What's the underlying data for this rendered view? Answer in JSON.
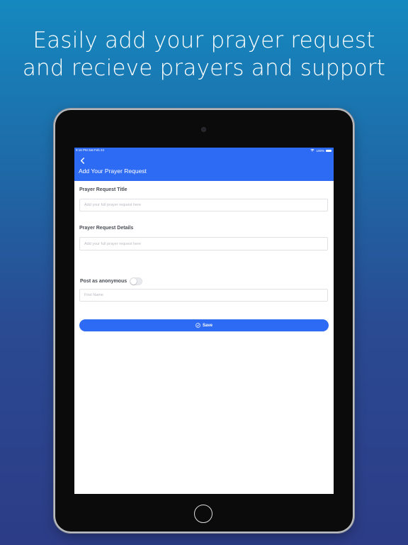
{
  "headline": {
    "line1": "Easily add your prayer request",
    "line2": "and recieve prayers and support"
  },
  "status_bar": {
    "time": "9:16 PM  Sat Feb 24",
    "battery": "100%"
  },
  "header": {
    "back_icon": "chevron-left-icon",
    "title": "Add Your Prayer Request"
  },
  "form": {
    "title_label": "Prayer Request Title",
    "title_placeholder": "Add your full prayer request here",
    "details_label": "Prayer Request Details",
    "details_placeholder": "Add your full prayer request here",
    "anonymous_label": "Post as anonymous",
    "anonymous_on": false,
    "first_name_placeholder": "First Name",
    "save_label": "Save",
    "save_icon": "check-circle-icon"
  },
  "colors": {
    "accent": "#2e6bf5",
    "background_top": "#1589bf",
    "background_bottom": "#2c3c86"
  }
}
